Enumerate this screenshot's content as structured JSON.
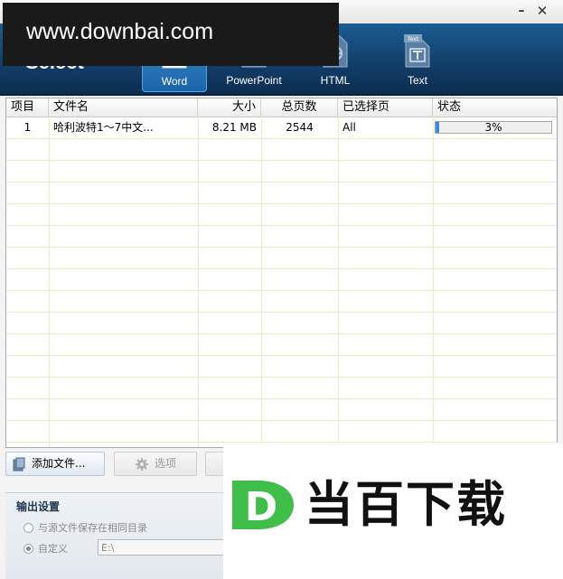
{
  "window": {
    "minimize_label": "–",
    "close_label": "✕"
  },
  "header": {
    "brand_text": "Select",
    "formats": [
      {
        "label": "Word",
        "icon": "word-doc-icon",
        "selected": true
      },
      {
        "label": "PowerPoint",
        "icon": "powerpoint-icon",
        "selected": false
      },
      {
        "label": "HTML",
        "icon": "html-doc-icon",
        "selected": false
      },
      {
        "label": "Text",
        "icon": "text-doc-icon",
        "icon_tag": "Text",
        "selected": false
      }
    ]
  },
  "grid": {
    "columns": [
      "项目",
      "文件名",
      "大小",
      "总页数",
      "已选择页",
      "状态"
    ],
    "rows": [
      {
        "index": "1",
        "filename": "哈利波特1～7中文...",
        "size": "8.21  MB",
        "total_pages": "2544",
        "selected_pages": "All",
        "status_text": "3%",
        "progress": 0.03
      }
    ]
  },
  "toolbar": {
    "add_files_label": "添加文件...",
    "options_label": "选项"
  },
  "output_settings": {
    "title": "输出设置",
    "option_same_dir": "与源文件保存在相同目录",
    "option_custom": "自定义",
    "custom_path": "E:\\"
  },
  "watermarks": {
    "top_text": "www.downbai.com",
    "bottom_text": "当百下载",
    "bottom_logo_letter": "D"
  },
  "colors": {
    "header_dark": "#0c2d50",
    "header_light": "#1b5c92",
    "progress": "#3a8be0",
    "logo_green": "#3fbf4a"
  }
}
